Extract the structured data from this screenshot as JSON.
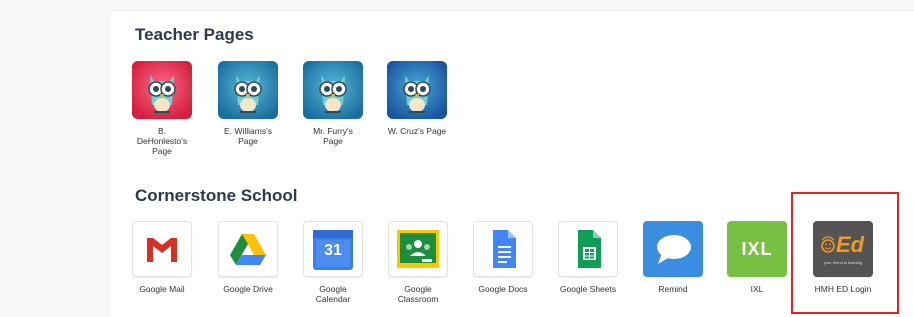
{
  "sections": {
    "teachers": {
      "title": "Teacher Pages",
      "items": [
        {
          "label": "B. DeHonlesto's Page",
          "label_lines": [
            "B.",
            "DeHonlesto's",
            "Page"
          ],
          "bg": "#e8364f",
          "icon": "owl-avatar-icon"
        },
        {
          "label": "E. Williams's Page",
          "label_lines": [
            "E. Williams's",
            "Page"
          ],
          "bg": "#1f8fb8",
          "icon": "owl-avatar-icon"
        },
        {
          "label": "Mr. Furry's Page",
          "label_lines": [
            "Mr. Furry's",
            "Page"
          ],
          "bg": "#1f8fb8",
          "icon": "owl-avatar-icon"
        },
        {
          "label": "W. Cruz's Page",
          "label_lines": [
            "W. Cruz's Page"
          ],
          "bg": "#1f6fb8",
          "icon": "owl-avatar-icon"
        }
      ]
    },
    "school": {
      "title": "Cornerstone School",
      "items": [
        {
          "label": "Google Mail",
          "label_lines": [
            "Google Mail"
          ],
          "icon": "gmail-icon"
        },
        {
          "label": "Google Drive",
          "label_lines": [
            "Google Drive"
          ],
          "icon": "google-drive-icon"
        },
        {
          "label": "Google Calendar",
          "label_lines": [
            "Google",
            "Calendar"
          ],
          "icon": "google-calendar-icon",
          "badge_text": "31"
        },
        {
          "label": "Google Classroom",
          "label_lines": [
            "Google",
            "Classroom"
          ],
          "icon": "google-classroom-icon"
        },
        {
          "label": "Google Docs",
          "label_lines": [
            "Google Docs"
          ],
          "icon": "google-docs-icon"
        },
        {
          "label": "Google Sheets",
          "label_lines": [
            "Google Sheets"
          ],
          "icon": "google-sheets-icon"
        },
        {
          "label": "Remind",
          "label_lines": [
            "Remind"
          ],
          "icon": "remind-icon"
        },
        {
          "label": "IXL",
          "label_lines": [
            "IXL"
          ],
          "icon": "ixl-icon",
          "badge_text": "IXL"
        },
        {
          "label": "HMH ED Login",
          "label_lines": [
            "HMH ED Login"
          ],
          "icon": "hmh-ed-icon",
          "badge_text": "Ed",
          "tagline": "your friend in learning"
        }
      ]
    }
  },
  "colors": {
    "title": "#2e3a4c",
    "highlight_border": "#e0242b",
    "gmail_red": "#d93025",
    "calendar_blue": "#3f7ee8",
    "classroom_green": "#1e8e3e",
    "docs_blue": "#4285f4",
    "sheets_green": "#0f9d58",
    "remind_blue": "#3b8de0",
    "ixl_green": "#78c043",
    "hmh_bg": "#545454",
    "hmh_orange": "#f29a1f"
  }
}
